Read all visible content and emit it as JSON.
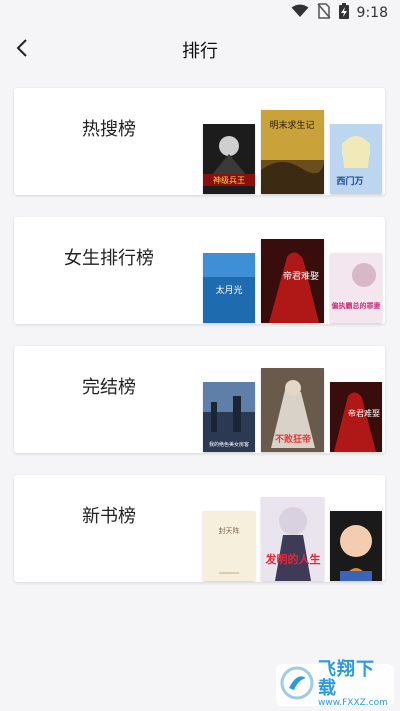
{
  "status_bar": {
    "time": "9:18"
  },
  "header": {
    "title": "排行"
  },
  "cards": [
    {
      "label": "热搜榜",
      "covers": [
        {
          "title_text": "神级兵王"
        },
        {
          "title_text": "明末求生记"
        },
        {
          "title_text": "西门万"
        }
      ]
    },
    {
      "label": "女生排行榜",
      "covers": [
        {
          "title_text": "太月光"
        },
        {
          "title_text": "帝君难娶"
        },
        {
          "title_text": "偏执霸总的罪妻"
        }
      ]
    },
    {
      "label": "完结榜",
      "covers": [
        {
          "title_text": "我的绝色美女房客"
        },
        {
          "title_text": "不败狂帝"
        },
        {
          "title_text": "帝君难娶"
        }
      ]
    },
    {
      "label": "新书榜",
      "covers": [
        {
          "title_text": "封天阵"
        },
        {
          "title_text": "发明的人生"
        },
        {
          "title_text": ""
        }
      ]
    }
  ],
  "watermark": {
    "main": "飞翔下载",
    "url": "www.FXXZ.com"
  },
  "colors": {
    "background": "#f5f5f7",
    "card": "#ffffff",
    "watermark": "#2a9be0"
  }
}
